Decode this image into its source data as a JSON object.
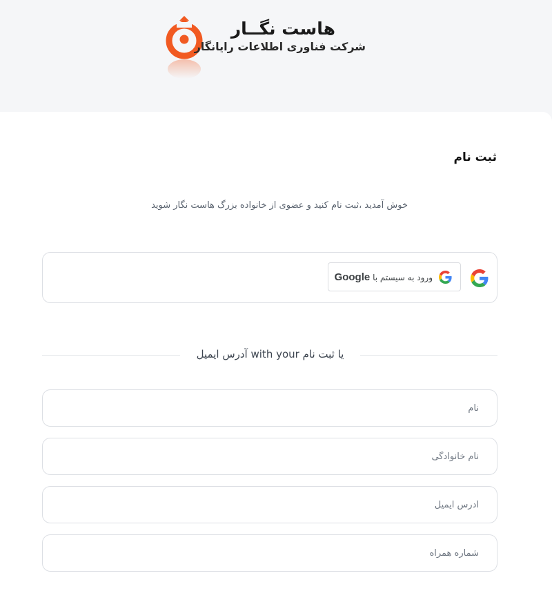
{
  "brand": {
    "name": "هاست نگــار",
    "tagline": "شرکت فناوری اطلاعات رایانگار",
    "logo_icon": "hostnegar-logo-icon",
    "accent_color": "#f15a22"
  },
  "form": {
    "title": "ثبت نام",
    "welcome": "خوش آمدید ،ثبت نام کنید و عضوی از خانواده بزرگ هاست نگار شوید",
    "google_button": {
      "prefix": "ورود به سیستم با",
      "brand": "Google",
      "icon": "google-icon"
    },
    "divider_text": "یا ثبت نام with your آدرس ایمیل",
    "fields": {
      "first_name": {
        "placeholder": "نام",
        "value": ""
      },
      "last_name": {
        "placeholder": "نام خانوادگی",
        "value": ""
      },
      "email": {
        "placeholder": "آدرس ایمیل",
        "value": ""
      },
      "phone": {
        "placeholder": "شماره همراه",
        "value": ""
      }
    }
  }
}
